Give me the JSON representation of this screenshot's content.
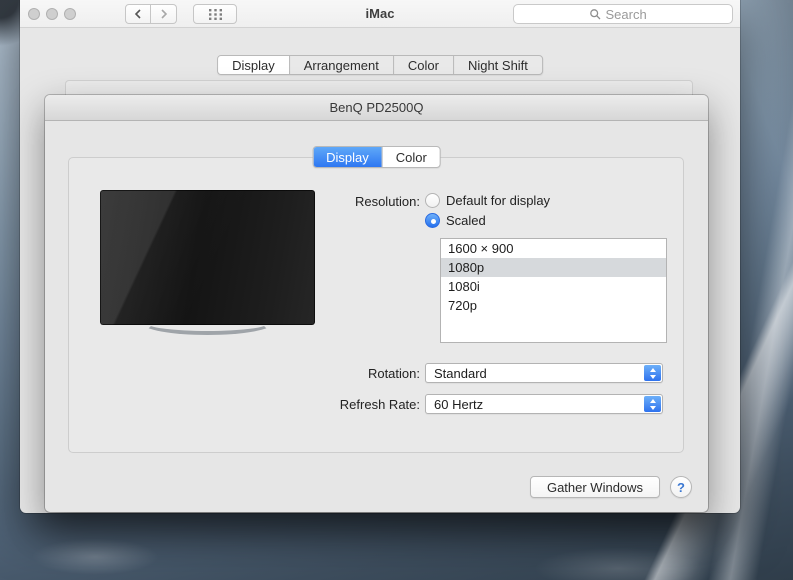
{
  "colors": {
    "accent_blue": "#2e77f2",
    "selection_gray": "#d6d9dc"
  },
  "toolbar": {
    "title": "iMac",
    "search_placeholder": "Search"
  },
  "main_window": {
    "selected_tab": "Display",
    "tabs": [
      {
        "label": "Display"
      },
      {
        "label": "Arrangement"
      },
      {
        "label": "Color"
      },
      {
        "label": "Night Shift"
      }
    ]
  },
  "display_window": {
    "title": "BenQ PD2500Q",
    "selected_tab": "Display",
    "tabs": [
      {
        "label": "Display"
      },
      {
        "label": "Color"
      }
    ],
    "resolution": {
      "label": "Resolution:",
      "options": [
        {
          "label": "Default for display",
          "selected": false
        },
        {
          "label": "Scaled",
          "selected": true
        }
      ]
    },
    "scaled_resolutions": {
      "selected": "1080p",
      "items": [
        {
          "label": "1600 × 900"
        },
        {
          "label": "1080p"
        },
        {
          "label": "1080i"
        },
        {
          "label": "720p"
        }
      ]
    },
    "rotation": {
      "label": "Rotation:",
      "value": "Standard"
    },
    "refresh_rate": {
      "label": "Refresh Rate:",
      "value": "60 Hertz"
    },
    "gather_windows_label": "Gather Windows",
    "help_label": "?"
  }
}
